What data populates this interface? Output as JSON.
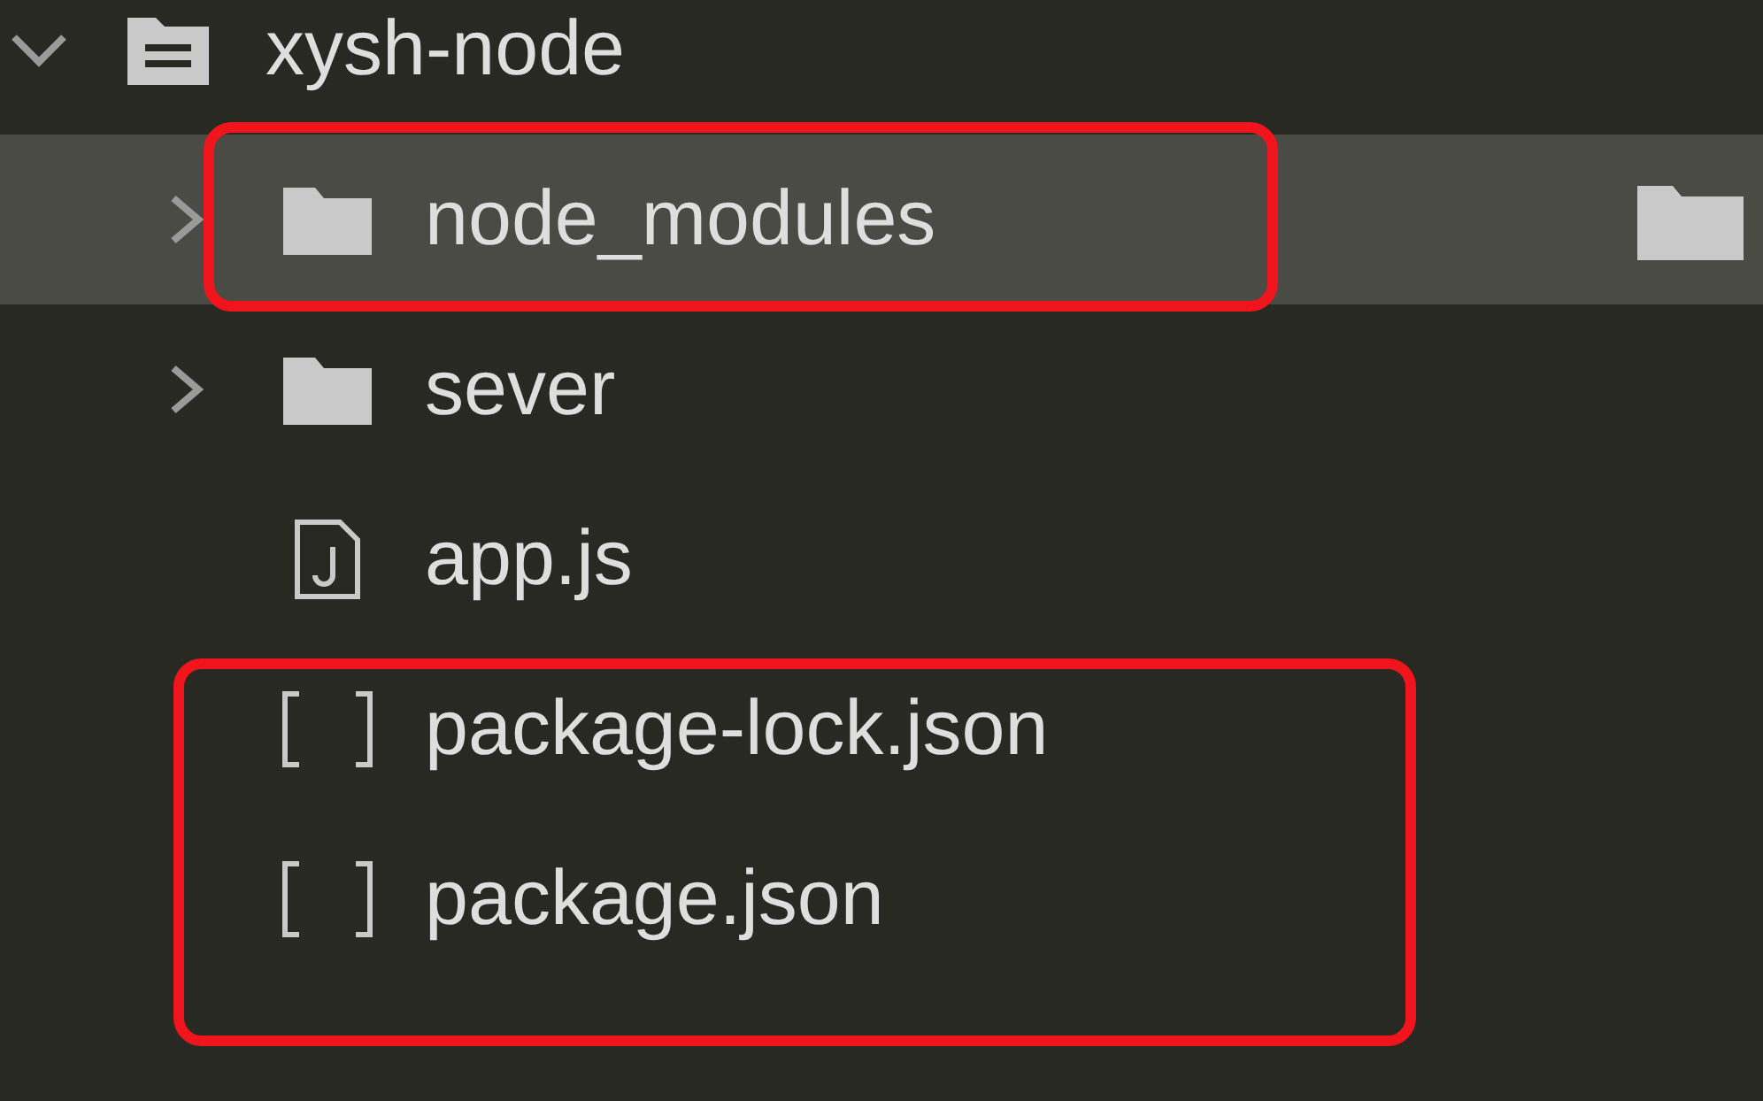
{
  "tree": {
    "label": "xysh-node",
    "kind": "folder",
    "expanded": true,
    "selected": false,
    "outlined": false,
    "children": [
      {
        "label": "node_modules",
        "kind": "folder",
        "expanded": false,
        "selected": true,
        "outlined": true,
        "side_icon": true
      },
      {
        "label": "sever",
        "kind": "folder",
        "expanded": false,
        "selected": false,
        "outlined": false
      },
      {
        "label": "app.js",
        "kind": "js",
        "selected": false,
        "outlined": false
      },
      {
        "label": "package-lock.json",
        "kind": "json",
        "selected": false,
        "outlined": true
      },
      {
        "label": "package.json",
        "kind": "json",
        "selected": false,
        "outlined": true
      }
    ]
  }
}
